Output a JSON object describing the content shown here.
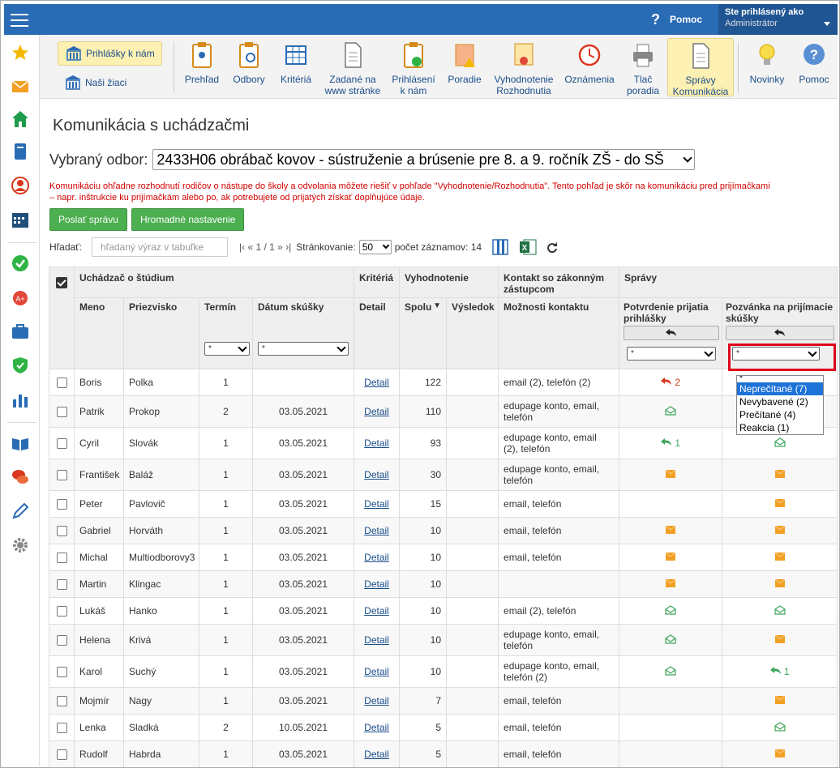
{
  "topbar": {
    "help_label": "Pomoc",
    "user_line1": "Ste prihlásený ako",
    "user_line2": "Administrátor"
  },
  "sidebar": {
    "icons": [
      "star-icon",
      "mail-icon",
      "home-icon",
      "book-icon",
      "person-icon",
      "calendar-icon",
      "check-icon",
      "apple-icon",
      "briefcase-icon",
      "shield-icon",
      "chart-icon",
      "open-book-icon",
      "chat-icon",
      "pen-icon",
      "gear-icon"
    ]
  },
  "toolbar": {
    "prihlasky": "Prihlášky k nám",
    "ziaci": "Naši žiaci",
    "buttons": [
      {
        "l1": "Prehľad",
        "l2": ""
      },
      {
        "l1": "Odbory",
        "l2": ""
      },
      {
        "l1": "Kritériá",
        "l2": ""
      },
      {
        "l1": "Zadané na",
        "l2": "www stránke"
      },
      {
        "l1": "Prihlásení",
        "l2": "k nám"
      },
      {
        "l1": "Poradie",
        "l2": ""
      },
      {
        "l1": "Vyhodnotenie",
        "l2": "Rozhodnutia"
      },
      {
        "l1": "Oznámenia",
        "l2": ""
      },
      {
        "l1": "Tlač",
        "l2": "poradia"
      },
      {
        "l1": "Správy",
        "l2": "Komunikácia"
      },
      {
        "l1": "Novinky",
        "l2": ""
      },
      {
        "l1": "Pomoc",
        "l2": ""
      }
    ]
  },
  "page": {
    "title": "Komunikácia s uchádzačmi",
    "odbor_label": "Vybraný odbor:",
    "odbor_value": "2433H06 obrábač kovov - sústruženie a brúsenie pre 8. a 9. ročník ZŠ - do SŠ",
    "warning_l1": "Komunikáciu ohľadne rozhodnutí rodičov o nástupe do školy a odvolania môžete riešiť v pohľade \"Vyhodnotenie/Rozhodnutia\". Tento pohľad je skôr na komunikáciu pred prijímačkami",
    "warning_l2": "– napr. inštrukcie ku prijímačkám alebo po, ak potrebujete od prijatých získať doplňujúce údaje.",
    "btn_send": "Poslať správu",
    "btn_bulk": "Hromadné nastavenie",
    "search_label": "Hľadať:",
    "search_placeholder": "hľadaný výraz v tabuľke",
    "pager": "|‹ « 1 / 1 » ›|",
    "paging_label": "Stránkovanie:",
    "paging_value": "50",
    "count_label": "počet záznamov: 14"
  },
  "table": {
    "groups": {
      "applicant": "Uchádzač o štúdium",
      "criteria": "Kritériá",
      "eval": "Vyhodnotenie",
      "contact": "Kontakt so zákonným zástupcom",
      "messages": "Správy"
    },
    "cols": {
      "meno": "Meno",
      "priezvisko": "Priezvisko",
      "termin": "Termín",
      "datum": "Dátum skúšky",
      "detail": "Detail",
      "spolu": "Spolu",
      "sort": "▼",
      "vysledok": "Výsledok",
      "moznosti": "Možnosti kontaktu",
      "potvrdenie": "Potvrdenie prijatia prihlášky",
      "pozvanka": "Pozvánka na prijímacie skúšky"
    },
    "filter_value": "*",
    "rows": [
      {
        "meno": "Boris",
        "priezvisko": "Polka",
        "termin": "1",
        "datum": "",
        "detail": "Detail",
        "spolu": "122",
        "kontakt": "email (2), telefón (2)",
        "potv": "reply-red",
        "potv_n": "2",
        "poz": ""
      },
      {
        "meno": "Patrik",
        "priezvisko": "Prokop",
        "termin": "2",
        "datum": "03.05.2021",
        "detail": "Detail",
        "spolu": "110",
        "kontakt": "edupage konto, email, telefón",
        "potv": "env-green",
        "potv_n": "",
        "poz": ""
      },
      {
        "meno": "Cyril",
        "priezvisko": "Slovák",
        "termin": "1",
        "datum": "03.05.2021",
        "detail": "Detail",
        "spolu": "93",
        "kontakt": "edupage konto, email (2), telefón",
        "potv": "reply-green",
        "potv_n": "1",
        "poz": "env-green"
      },
      {
        "meno": "František",
        "priezvisko": "Baláž",
        "termin": "1",
        "datum": "03.05.2021",
        "detail": "Detail",
        "spolu": "30",
        "kontakt": "edupage konto, email, telefón",
        "potv": "env-orange",
        "potv_n": "",
        "poz": "env-orange"
      },
      {
        "meno": "Peter",
        "priezvisko": "Pavlovič",
        "termin": "1",
        "datum": "03.05.2021",
        "detail": "Detail",
        "spolu": "15",
        "kontakt": "email, telefón",
        "potv": "",
        "potv_n": "",
        "poz": "env-orange"
      },
      {
        "meno": "Gabriel",
        "priezvisko": "Horváth",
        "termin": "1",
        "datum": "03.05.2021",
        "detail": "Detail",
        "spolu": "10",
        "kontakt": "email, telefón",
        "potv": "env-orange",
        "potv_n": "",
        "poz": "env-orange"
      },
      {
        "meno": "Michal",
        "priezvisko": "Multiodborovy3",
        "termin": "1",
        "datum": "03.05.2021",
        "detail": "Detail",
        "spolu": "10",
        "kontakt": "email, telefón",
        "potv": "env-orange",
        "potv_n": "",
        "poz": "env-orange"
      },
      {
        "meno": "Martin",
        "priezvisko": "Klingac",
        "termin": "1",
        "datum": "03.05.2021",
        "detail": "Detail",
        "spolu": "10",
        "kontakt": "",
        "potv": "env-orange",
        "potv_n": "",
        "poz": "env-orange"
      },
      {
        "meno": "Lukáš",
        "priezvisko": "Hanko",
        "termin": "1",
        "datum": "03.05.2021",
        "detail": "Detail",
        "spolu": "10",
        "kontakt": "email (2), telefón",
        "potv": "env-green",
        "potv_n": "",
        "poz": "env-green"
      },
      {
        "meno": "Helena",
        "priezvisko": "Krivá",
        "termin": "1",
        "datum": "03.05.2021",
        "detail": "Detail",
        "spolu": "10",
        "kontakt": "edupage konto, email, telefón",
        "potv": "env-green",
        "potv_n": "",
        "poz": "env-orange"
      },
      {
        "meno": "Karol",
        "priezvisko": "Suchý",
        "termin": "1",
        "datum": "03.05.2021",
        "detail": "Detail",
        "spolu": "10",
        "kontakt": "edupage konto, email, telefón (2)",
        "potv": "env-green",
        "potv_n": "",
        "poz": "reply-green",
        "poz_n": "1"
      },
      {
        "meno": "Mojmír",
        "priezvisko": "Nagy",
        "termin": "1",
        "datum": "03.05.2021",
        "detail": "Detail",
        "spolu": "7",
        "kontakt": "email, telefón",
        "potv": "",
        "potv_n": "",
        "poz": "env-orange"
      },
      {
        "meno": "Lenka",
        "priezvisko": "Sladká",
        "termin": "2",
        "datum": "10.05.2021",
        "detail": "Detail",
        "spolu": "5",
        "kontakt": "email, telefón",
        "potv": "",
        "potv_n": "",
        "poz": "env-green"
      },
      {
        "meno": "Rudolf",
        "priezvisko": "Habrda",
        "termin": "1",
        "datum": "03.05.2021",
        "detail": "Detail",
        "spolu": "5",
        "kontakt": "email, telefón",
        "potv": "",
        "potv_n": "",
        "poz": "env-orange"
      }
    ]
  },
  "dropdown": {
    "options": [
      "*",
      "Neprečítané (7)",
      "Nevybavené (2)",
      "Prečítané (4)",
      "Reakcia (1)"
    ],
    "highlighted": 1
  },
  "colors": {
    "topbar": "#2a6bb5",
    "green": "#4caf50",
    "orange": "#f2a024",
    "red": "#d9381e",
    "highlight": "#e0001a"
  }
}
